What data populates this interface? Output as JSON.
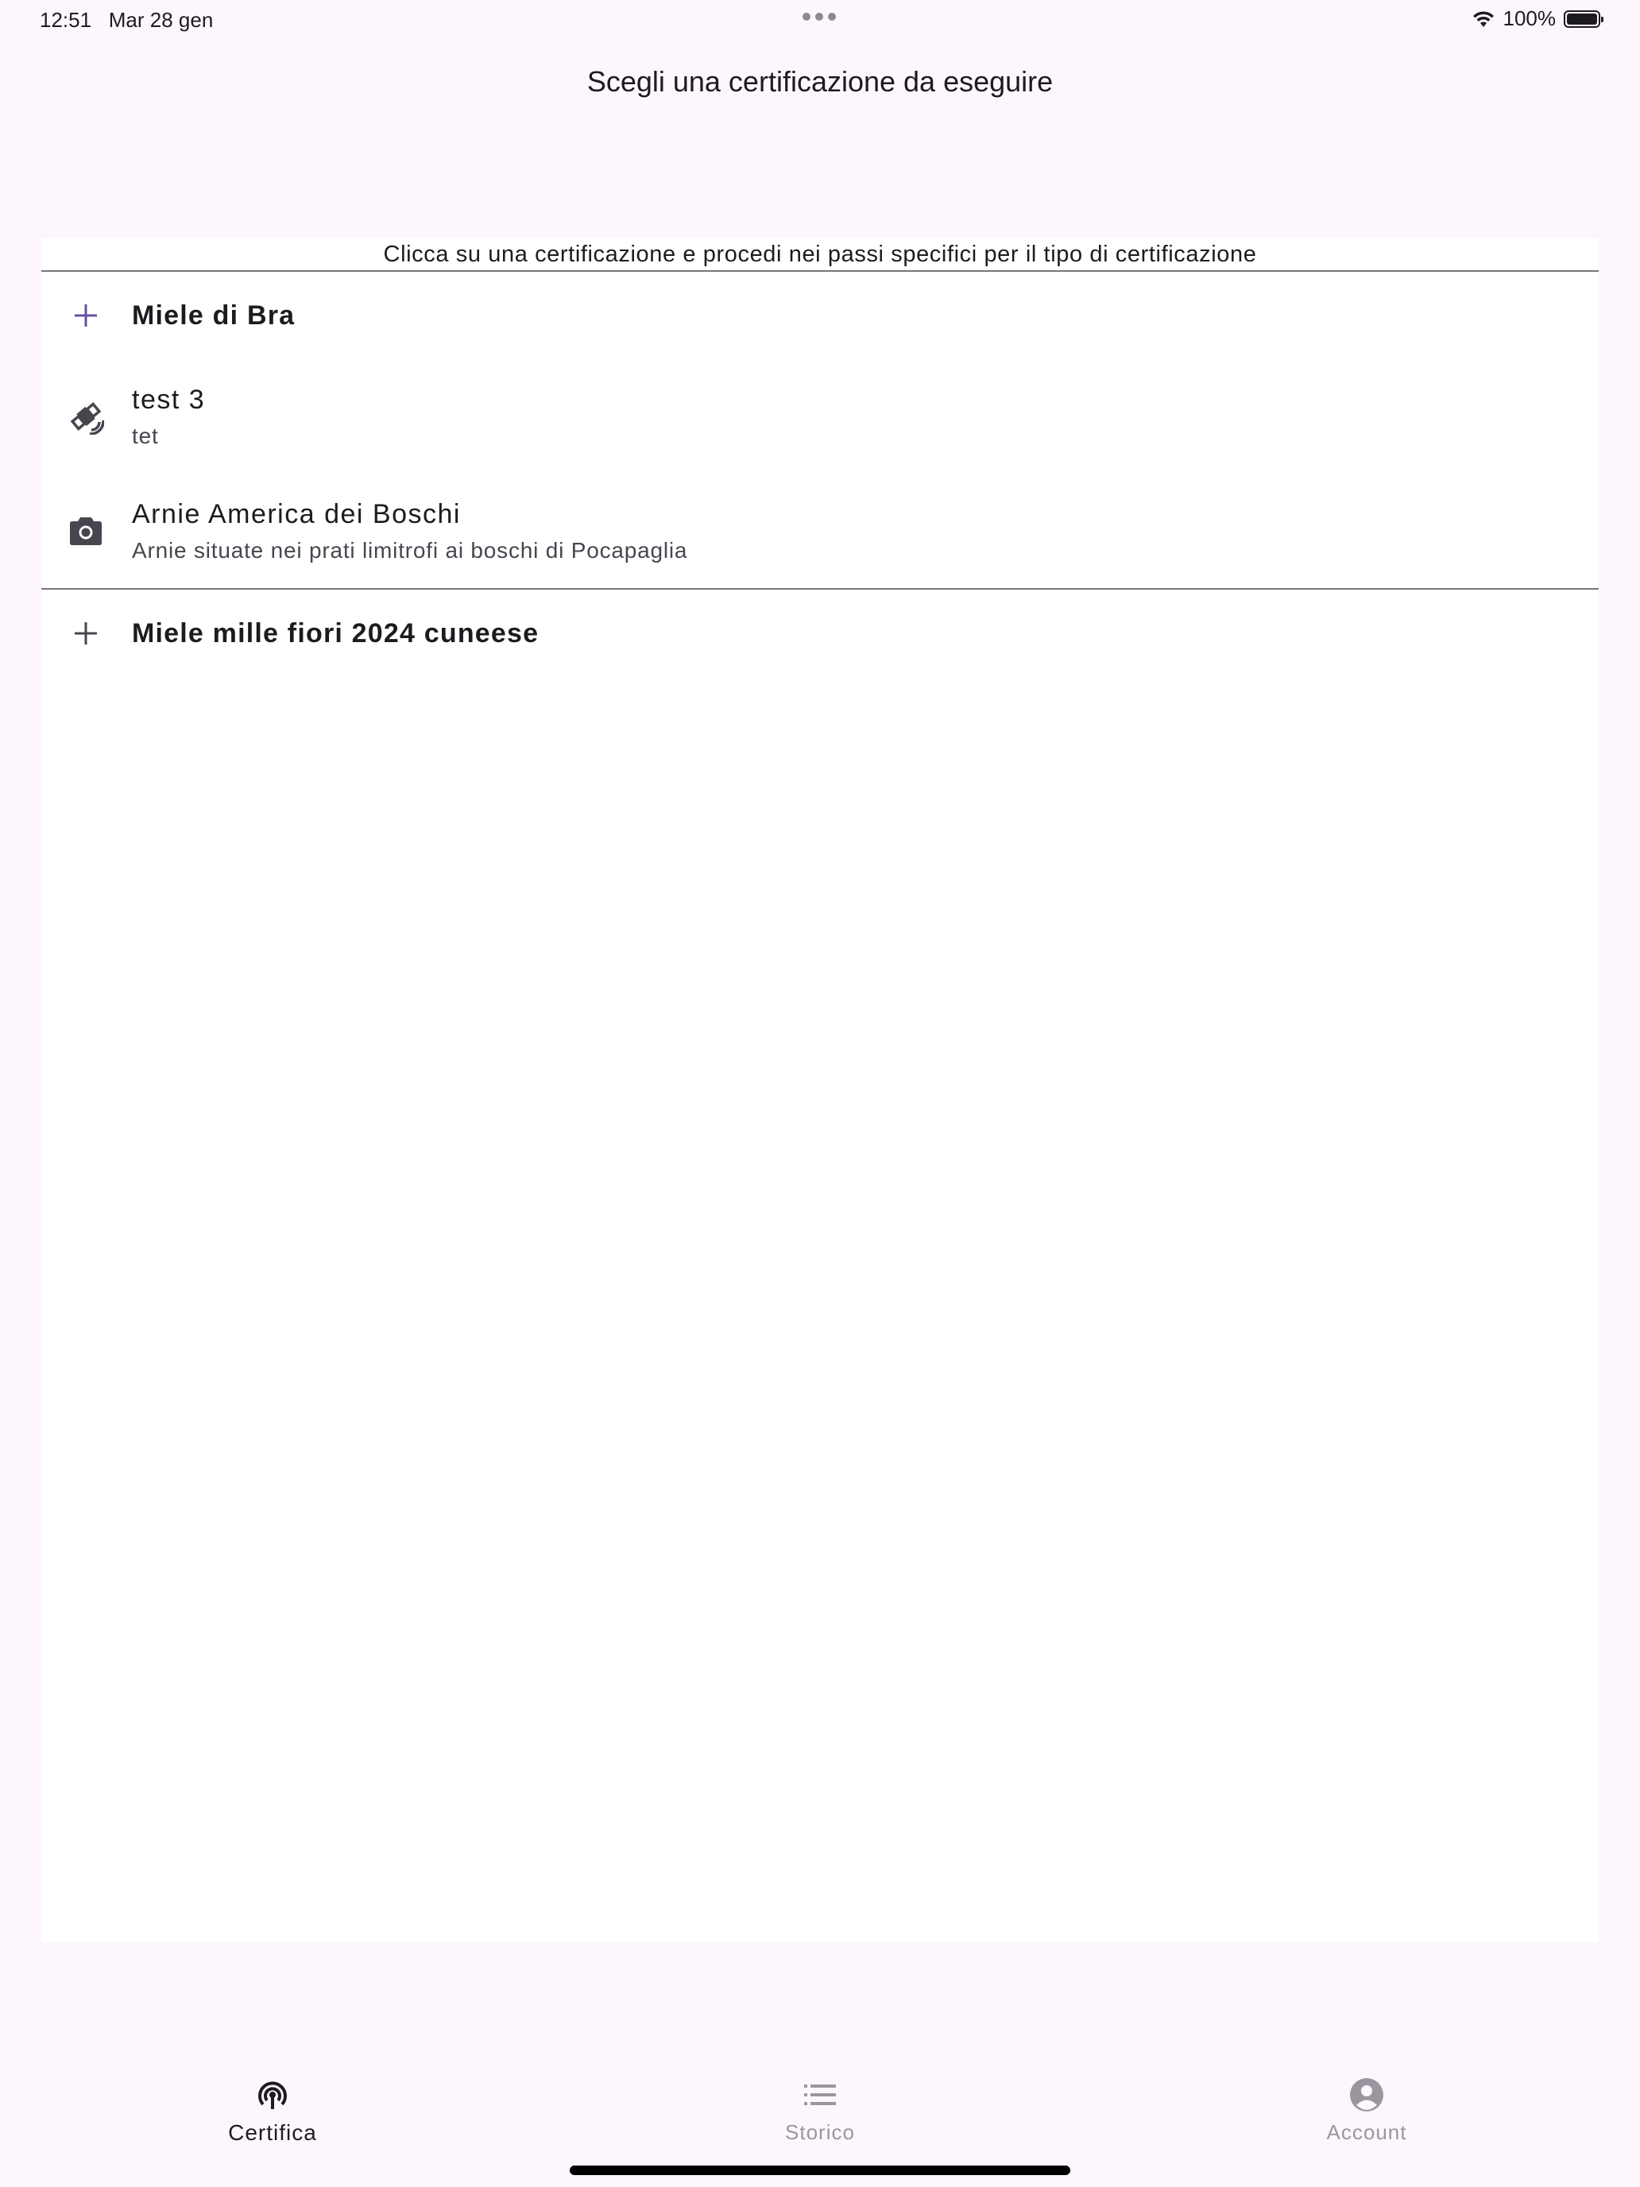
{
  "status_bar": {
    "time": "12:51",
    "date": "Mar 28 gen",
    "battery": "100%"
  },
  "header": {
    "title": "Scegli una certificazione da eseguire"
  },
  "instructions": "Clicca su una certificazione e procedi nei passi specifici per il tipo di certificazione",
  "groups": [
    {
      "label": "Miele di Bra",
      "icon": "plus-icon",
      "expanded": true,
      "accent": "#6750a4",
      "items": [
        {
          "title": "test 3",
          "subtitle": "tet",
          "icon": "satellite-icon"
        },
        {
          "title": "Arnie America dei Boschi",
          "subtitle": "Arnie situate nei prati limitrofi ai boschi di Pocapaglia",
          "icon": "camera-icon"
        }
      ]
    },
    {
      "label": "Miele mille fiori 2024 cuneese",
      "icon": "plus-icon",
      "expanded": false
    }
  ],
  "bottom_nav": {
    "items": [
      {
        "label": "Certifica",
        "icon": "certify-icon",
        "active": true
      },
      {
        "label": "Storico",
        "icon": "list-icon",
        "active": false
      },
      {
        "label": "Account",
        "icon": "account-icon",
        "active": false
      }
    ]
  }
}
